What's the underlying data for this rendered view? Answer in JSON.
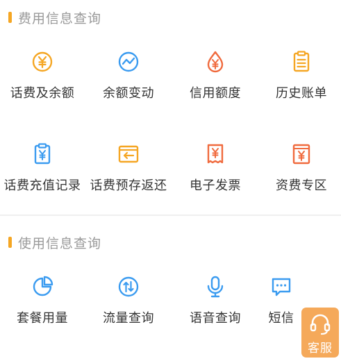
{
  "colors": {
    "accent": "#f5a623",
    "blue": "#3a9bf0",
    "orange": "#f5a623",
    "red": "#f06a3d",
    "service_bg": "#f5a95a"
  },
  "fee_section": {
    "title": "费用信息查询",
    "items": [
      {
        "label": "话费及余额",
        "icon": "yuan-circle-icon"
      },
      {
        "label": "余额变动",
        "icon": "trend-circle-icon"
      },
      {
        "label": "信用额度",
        "icon": "credit-drop-icon"
      },
      {
        "label": "历史账单",
        "icon": "clipboard-icon"
      },
      {
        "label": "话费充值记录",
        "icon": "recharge-record-icon"
      },
      {
        "label": "话费预存返还",
        "icon": "wallet-return-icon"
      },
      {
        "label": "电子发票",
        "icon": "invoice-icon"
      },
      {
        "label": "资费专区",
        "icon": "tariff-book-icon"
      }
    ]
  },
  "usage_section": {
    "title": "使用信息查询",
    "items": [
      {
        "label": "套餐用量",
        "icon": "pie-chart-icon"
      },
      {
        "label": "流量查询",
        "icon": "data-flow-icon"
      },
      {
        "label": "语音查询",
        "icon": "microphone-icon"
      },
      {
        "label": "短信",
        "icon": "message-icon"
      }
    ]
  },
  "customer_service": {
    "label": "客服",
    "icon": "headset-icon"
  }
}
